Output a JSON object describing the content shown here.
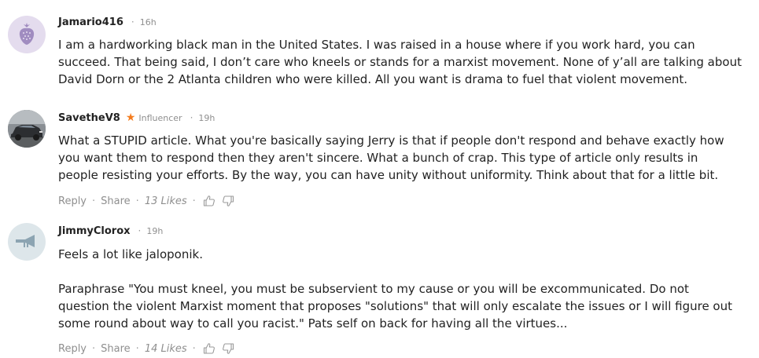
{
  "comments": [
    {
      "username": "Jamario416",
      "avatar_icon": "strawberry-icon",
      "avatar_bg": "#e4dcee",
      "avatar_fg": "#a08cc0",
      "time": "16h",
      "body_lines": [
        "I am a hardworking black man in the United States. I was raised in a house where if you work hard, you can",
        "succeed. That being said, I don’t care who kneels or stands for a marxist movement. None of y’all are talking about",
        "David Dorn or the 2 Atlanta children who were killed. All you want is drama to fuel that violent movement."
      ]
    },
    {
      "username": "SavetheV8",
      "avatar_icon": "car-photo-icon",
      "badge": "Influencer",
      "badge_icon": "star-icon",
      "badge_color": "#f47c1e",
      "time": "19h",
      "body_lines": [
        "What a STUPID article. What you're basically saying Jerry is that if people don't respond and behave exactly how",
        "you want them to respond then they aren't sincere. What a bunch of crap. This type of article only results in",
        "people resisting your efforts. By the way, you can have unity without uniformity. Think about that for a little bit."
      ],
      "reply_label": "Reply",
      "share_label": "Share",
      "likes": "13 Likes"
    },
    {
      "username": "JimmyClorox",
      "avatar_icon": "trumpet-icon",
      "avatar_bg": "#dde6ea",
      "avatar_fg": "#8ca4b2",
      "time": "19h",
      "body_lines": [
        "Feels a lot like jaloponik.",
        "",
        "Paraphrase \"You must kneel, you must be subservient to my cause or you will be excommunicated.  Do not",
        "question the violent Marxist moment that proposes \"solutions\"  that will only escalate the issues or I will figure out",
        "some round about way to call you racist.\"  Pats self on back for having all the virtues..."
      ],
      "reply_label": "Reply",
      "share_label": "Share",
      "likes": "14 Likes"
    }
  ],
  "separator": "·"
}
